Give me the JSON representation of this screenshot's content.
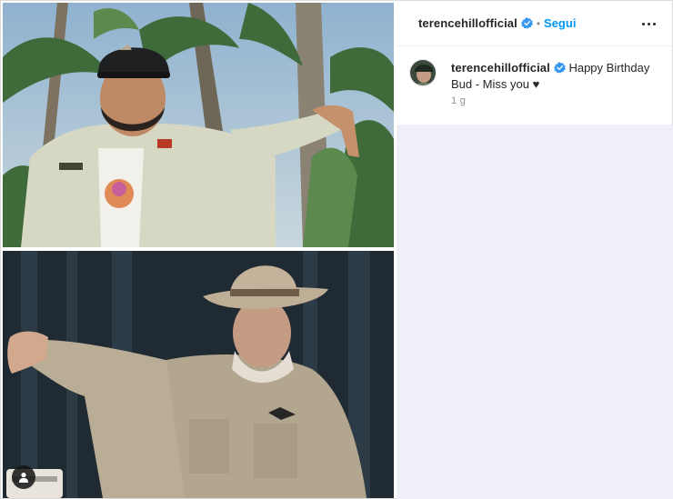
{
  "post": {
    "username": "terencehillofficial",
    "separator": "•",
    "follow_label": "Segui",
    "more_options_icon": "more-horizontal-icon",
    "verified_icon": "verified-badge-icon"
  },
  "caption": {
    "username": "terencehillofficial",
    "text": "Happy Birthday Bud - Miss you ♥",
    "timestamp": "1 g"
  },
  "media": {
    "tag_icon": "user-tag-icon"
  },
  "colors": {
    "follow_blue": "#0095f6",
    "verified_blue": "#3897f0",
    "panel_background": "#efeff8",
    "text_primary": "#262626",
    "text_secondary": "#8e8e8e"
  }
}
